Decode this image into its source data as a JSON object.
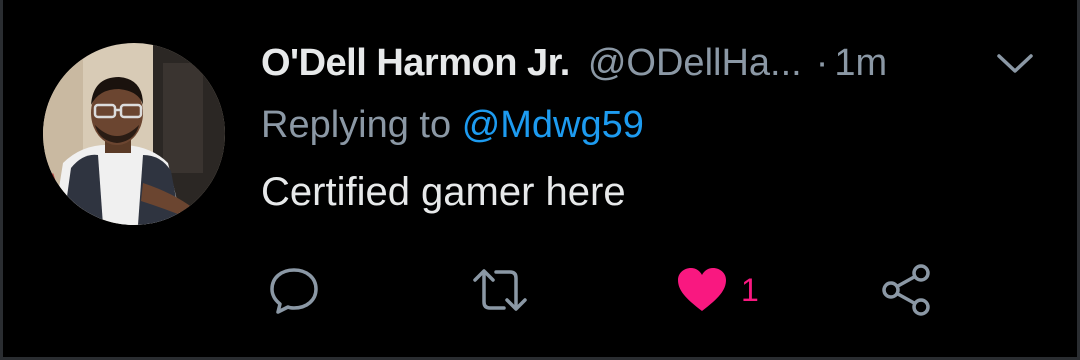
{
  "tweet": {
    "display_name": "O'Dell Harmon Jr.",
    "handle": "@ODellHa...",
    "separator": "·",
    "time": "1m",
    "reply_prefix": "Replying to",
    "reply_mention": "@Mdwg59",
    "text": "Certified gamer here"
  },
  "actions": {
    "reply_icon": "speech-bubble-icon",
    "retweet_icon": "retweet-icon",
    "like_icon": "heart-icon",
    "like_count": "1",
    "share_icon": "share-icon",
    "liked": true
  },
  "colors": {
    "background": "#000000",
    "primary_text": "#e7e9ea",
    "secondary_text": "#8b98a5",
    "mention": "#1d9bf0",
    "like": "#f91880"
  }
}
